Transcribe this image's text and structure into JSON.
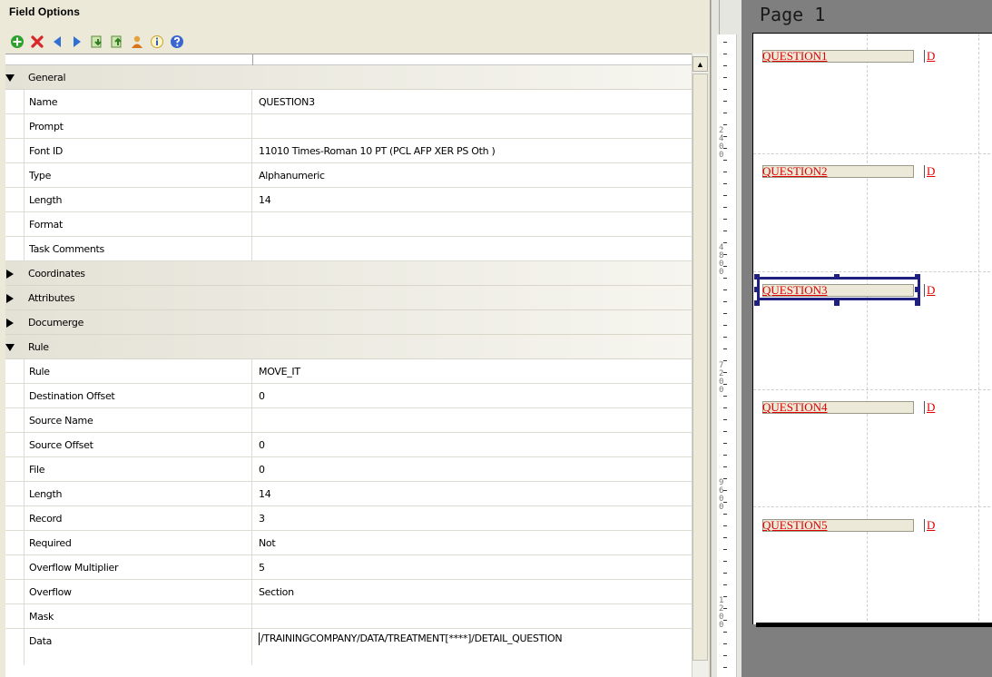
{
  "panel": {
    "title": "Field Options",
    "toolbar": [
      {
        "icon": "add-icon",
        "label": "Add"
      },
      {
        "icon": "delete-icon",
        "label": "Delete"
      },
      {
        "icon": "previous-icon",
        "label": "Previous"
      },
      {
        "icon": "next-icon",
        "label": "Next"
      },
      {
        "icon": "move-down-icon",
        "label": "Move down"
      },
      {
        "icon": "move-up-icon",
        "label": "Move up"
      },
      {
        "icon": "user-icon",
        "label": "User"
      },
      {
        "icon": "info-icon",
        "label": "Info"
      },
      {
        "icon": "help-icon",
        "label": "Help"
      }
    ]
  },
  "grid": {
    "general": {
      "label": "General",
      "rows": [
        {
          "name": "Name",
          "value": "QUESTION3"
        },
        {
          "name": "Prompt",
          "value": ""
        },
        {
          "name": "Font ID",
          "value": "11010 Times-Roman 10 PT (PCL AFP XER PS Oth )"
        },
        {
          "name": "Type",
          "value": "Alphanumeric"
        },
        {
          "name": "Length",
          "value": "14"
        },
        {
          "name": "Format",
          "value": ""
        },
        {
          "name": "Task Comments",
          "value": ""
        }
      ]
    },
    "collapsed_sections": [
      {
        "label": "Coordinates"
      },
      {
        "label": "Attributes"
      },
      {
        "label": "Documerge"
      }
    ],
    "rule": {
      "label": "Rule",
      "rows": [
        {
          "name": "Rule",
          "value": "MOVE_IT"
        },
        {
          "name": "Destination Offset",
          "value": "0"
        },
        {
          "name": "Source Name",
          "value": ""
        },
        {
          "name": "Source Offset",
          "value": "0"
        },
        {
          "name": "File",
          "value": "0"
        },
        {
          "name": "Length",
          "value": "14"
        },
        {
          "name": "Record",
          "value": "3"
        },
        {
          "name": "Required",
          "value": "Not"
        },
        {
          "name": "Overflow Multiplier",
          "value": "5"
        },
        {
          "name": "Overflow",
          "value": "Section"
        },
        {
          "name": "Mask",
          "value": ""
        }
      ],
      "data_row": {
        "name": "Data",
        "value": "/TRAININGCOMPANY/DATA/TREATMENT[****]/DETAIL_QUESTION"
      }
    }
  },
  "canvas": {
    "page_title": "Page 1",
    "selected_field": "QUESTION3",
    "fields": [
      {
        "label": "QUESTION1",
        "suffix": "D"
      },
      {
        "label": "QUESTION2",
        "suffix": "D"
      },
      {
        "label": "QUESTION3",
        "suffix": "D"
      },
      {
        "label": "QUESTION4",
        "suffix": "D"
      },
      {
        "label": "QUESTION5",
        "suffix": "D"
      }
    ],
    "ruler_marks": [
      "2",
      "4",
      "0",
      "0",
      "4",
      "8",
      "0",
      "0",
      "7",
      "2",
      "0",
      "0",
      "9",
      "6",
      "0",
      "0",
      "1",
      "2",
      "0",
      "0"
    ]
  },
  "colors": {
    "field_label": "#e00000",
    "selection": "#1f2080",
    "panel_bg": "#ece9d8",
    "canvas_bg": "#7f7f7f"
  }
}
